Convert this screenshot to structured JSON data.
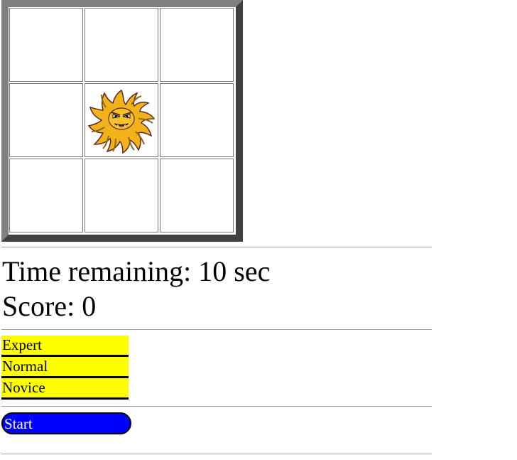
{
  "board": {
    "rows": 3,
    "cols": 3,
    "monster_cell": 4,
    "monster_icon": "hairy-monster-icon",
    "monster_colors": {
      "fur": "#f2b21a",
      "fur_dark": "#8a6a1c",
      "outline": "#5a2a2a"
    }
  },
  "status": {
    "time_label": "Time remaining: 10 sec",
    "score_label": "Score: 0"
  },
  "levels": [
    {
      "label": "Expert"
    },
    {
      "label": "Normal"
    },
    {
      "label": "Novice"
    }
  ],
  "controls": {
    "start_label": "Start"
  },
  "colors": {
    "level_bg": "#ffff00",
    "start_bg": "#0000ff",
    "start_text": "#ffffff"
  }
}
